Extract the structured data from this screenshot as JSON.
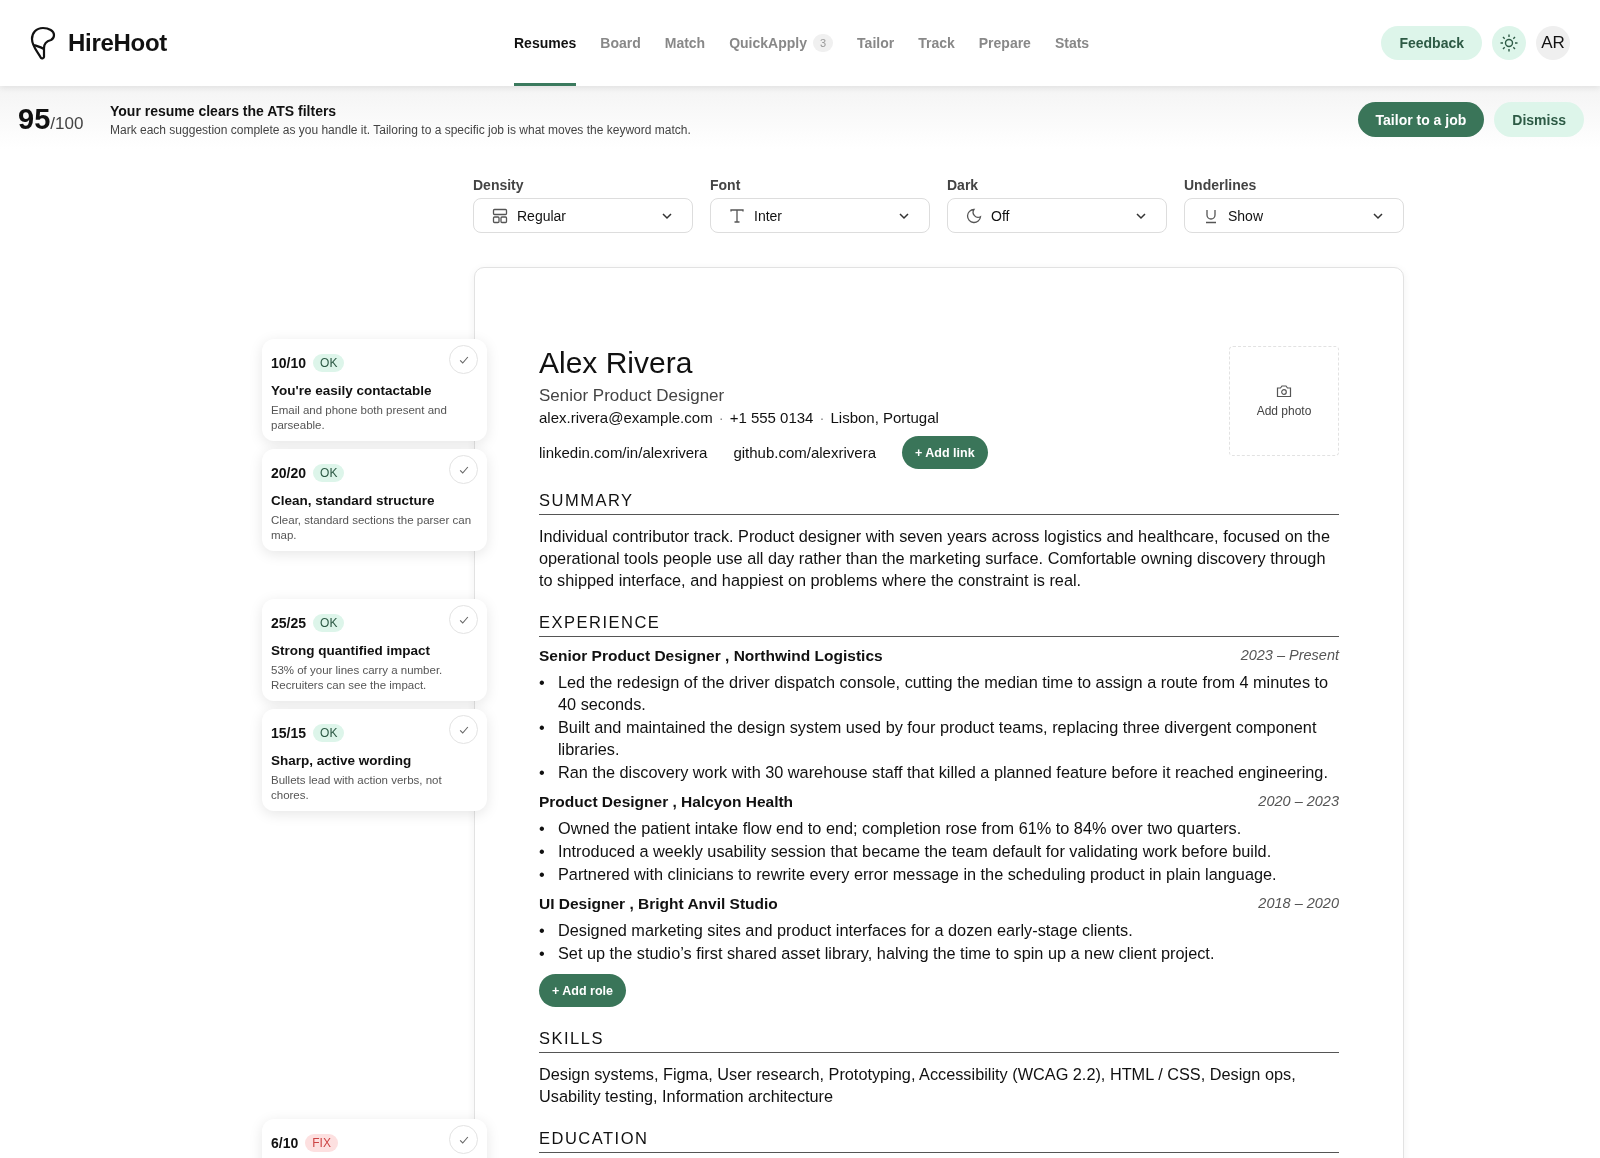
{
  "brand": {
    "name": "HireHoot"
  },
  "nav": [
    {
      "label": "Resumes",
      "selected": true
    },
    {
      "label": "Board",
      "selected": false
    },
    {
      "label": "Match",
      "selected": false
    },
    {
      "label": "QuickApply",
      "selected": false,
      "badge": "3"
    },
    {
      "label": "Tailor",
      "selected": false
    },
    {
      "label": "Track",
      "selected": false
    },
    {
      "label": "Prepare",
      "selected": false
    },
    {
      "label": "Stats",
      "selected": false
    }
  ],
  "header_actions": {
    "feedback": "Feedback",
    "avatar": "AR"
  },
  "banner": {
    "score": "95",
    "out_of": "/100",
    "title": "Your resume clears the ATS filters",
    "text": "Mark each suggestion complete as you handle it. Tailoring to a specific job is what moves the keyword match.",
    "primary": "Tailor to a job",
    "secondary": "Dismiss"
  },
  "settings": [
    {
      "label": "Density",
      "value": "Regular",
      "kind": "layout"
    },
    {
      "label": "Font",
      "value": "Inter",
      "kind": "font"
    },
    {
      "label": "Dark",
      "value": "Off",
      "kind": "moon"
    },
    {
      "label": "Underlines",
      "value": "Show",
      "kind": "underline"
    }
  ],
  "checks": [
    {
      "score": "10/10",
      "status": "OK",
      "kind": "ok",
      "title": "You're easily contactable",
      "text": "Email and phone both present and parseable."
    },
    {
      "score": "20/20",
      "status": "OK",
      "kind": "ok",
      "title": "Clean, standard structure",
      "text": "Clear, standard sections the parser can map."
    },
    {
      "score": "25/25",
      "status": "OK",
      "kind": "ok",
      "title": "Strong quantified impact",
      "text": "53% of your lines carry a number. Recruiters can see the impact."
    },
    {
      "score": "15/15",
      "status": "OK",
      "kind": "ok",
      "title": "Sharp, active wording",
      "text": "Bullets lead with action verbs, not chores."
    },
    {
      "score": "6/10",
      "status": "FIX",
      "kind": "fix"
    }
  ],
  "resume": {
    "name": "Alex Rivera",
    "headline": "Senior Product Designer",
    "contact": [
      {
        "text": "alex.rivera@example.com"
      },
      {
        "separator": "·",
        "text": "+1 555 0134"
      },
      {
        "separator": "·",
        "text": "Lisbon, Portugal"
      }
    ],
    "links": [
      "linkedin.com/in/alexrivera",
      "github.com/alexrivera"
    ],
    "add_link": {
      "icon": "+",
      "label": "Add link"
    },
    "add_photo": "Add photo",
    "summary_heading": "SUMMARY",
    "summary": "Individual contributor track. Product designer with seven years across logistics and healthcare, focused on the operational tools people use all day rather than the marketing surface. Comfortable owning discovery through to shipped interface, and happiest on problems where the constraint is real.",
    "experience_heading": "EXPERIENCE",
    "roles": [
      {
        "title": "Senior Product Designer , Northwind Logistics",
        "dates": "2023 – Present",
        "bullets": [
          {
            "marker": "•",
            "text": "Led the redesign of the driver dispatch console, cutting the median time to assign a route from 4 minutes to 40 seconds."
          },
          {
            "marker": "•",
            "text": "Built and maintained the design system used by four product teams, replacing three divergent component libraries."
          },
          {
            "marker": "•",
            "text": "Ran the discovery work with 30 warehouse staff that killed a planned feature before it reached engineering."
          }
        ]
      },
      {
        "title": "Product Designer , Halcyon Health",
        "dates": "2020 – 2023",
        "bullets": [
          {
            "marker": "•",
            "text": "Owned the patient intake flow end to end; completion rose from 61% to 84% over two quarters."
          },
          {
            "marker": "•",
            "text": "Introduced a weekly usability session that became the team default for validating work before build."
          },
          {
            "marker": "•",
            "text": "Partnered with clinicians to rewrite every error message in the scheduling product in plain language."
          }
        ]
      },
      {
        "title": "UI Designer , Bright Anvil Studio",
        "dates": "2018 – 2020",
        "bullets": [
          {
            "marker": "•",
            "text": "Designed marketing sites and product interfaces for a dozen early-stage clients."
          },
          {
            "marker": "•",
            "text": "Set up the studio’s first shared asset library, halving the time to spin up a new client project."
          }
        ]
      }
    ],
    "add_role": {
      "icon": "+",
      "label": "Add role"
    },
    "skills_heading": "SKILLS",
    "skills": "Design systems, Figma, User research, Prototyping, Accessibility (WCAG 2.2), HTML / CSS, Design ops, Usability testing, Information architecture",
    "education_heading": "EDUCATION"
  }
}
